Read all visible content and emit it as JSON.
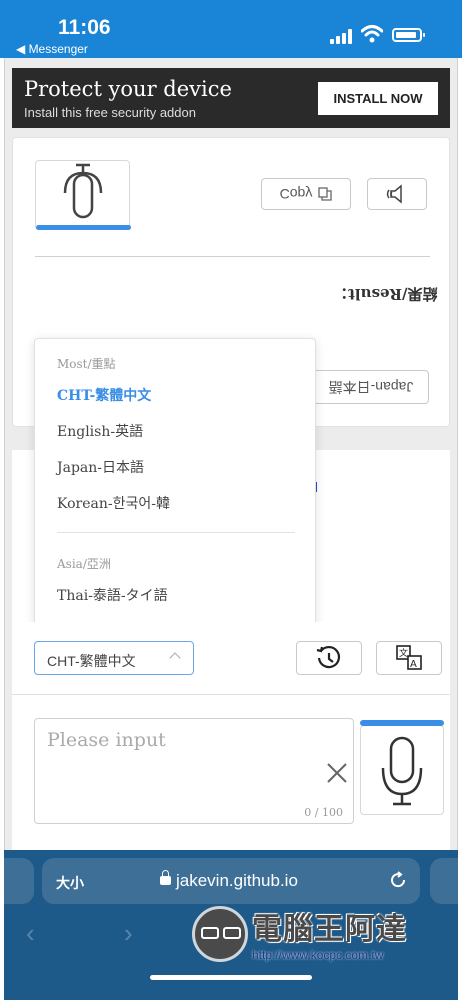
{
  "status_bar": {
    "time": "11:06",
    "back_app": "◀ Messenger",
    "accent_color": "#1a84d6"
  },
  "ad": {
    "title": "Protect your device",
    "subtitle": "Install this free security addon",
    "button_label": "INSTALL NOW"
  },
  "result_panel": {
    "copy_label": "Copy",
    "result_label": "結果/Result：",
    "language_chip": "Japan-日本語"
  },
  "dropdown": {
    "groups": [
      {
        "label": "Most/重點"
      },
      {
        "label": "Asia/亞洲"
      }
    ],
    "items": [
      {
        "label": "CHT-繁體中文",
        "selected": true
      },
      {
        "label": "English-英語"
      },
      {
        "label": "Japan-日本語"
      },
      {
        "label": "Korean-한국어-韓"
      },
      {
        "label": "Thai-泰語-タイ語"
      }
    ]
  },
  "input_panel": {
    "selected_language": "CHT-繁體中文",
    "placeholder": "Please input",
    "char_count": "0 / 100"
  },
  "browser": {
    "text_size_label": "大小",
    "url": "jakevin.github.io",
    "accent_color": "#1d5a8a"
  },
  "watermark": {
    "title": "電腦王阿達",
    "url": "http://www.kocpc.com.tw"
  }
}
